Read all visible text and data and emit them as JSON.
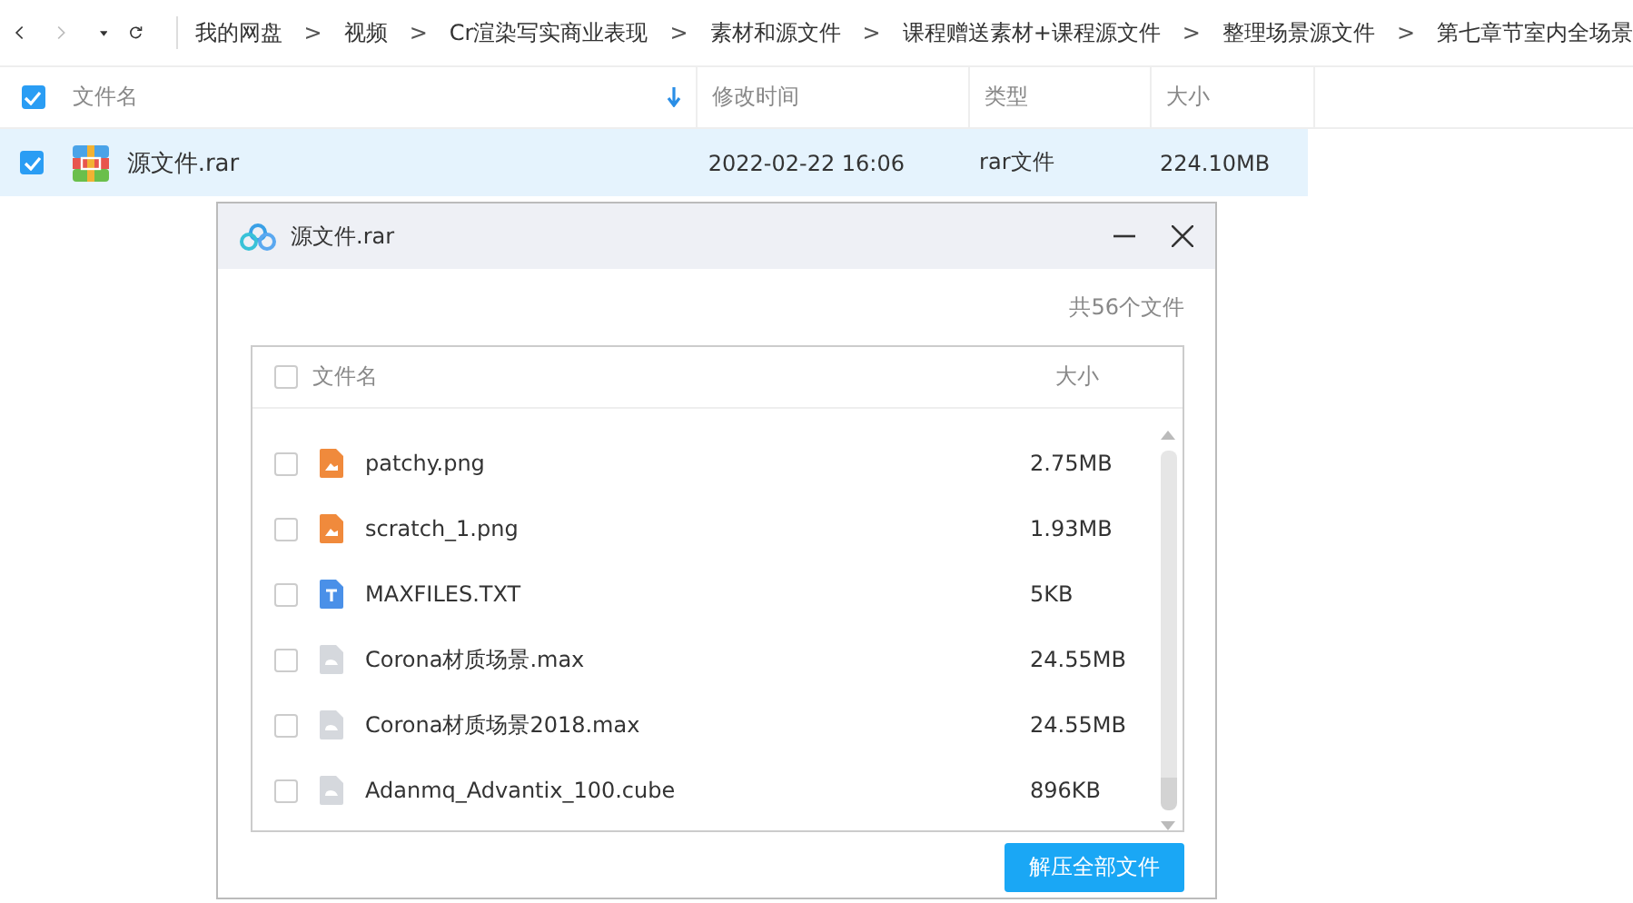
{
  "breadcrumb": {
    "separator": ">",
    "items": [
      "我的网盘",
      "视频",
      "Cr渲染写实商业表现",
      "素材和源文件",
      "课程赠送素材+课程源文件",
      "整理场景源文件",
      "第七章节室内全场景"
    ]
  },
  "table": {
    "select_all_checked": true,
    "columns": [
      {
        "label": "文件名",
        "sorted": true
      },
      {
        "label": "修改时间",
        "sorted": false
      },
      {
        "label": "类型",
        "sorted": false
      },
      {
        "label": "大小",
        "sorted": false
      }
    ],
    "rows": [
      {
        "name": "源文件.rar",
        "modified": "2022-02-22 16:06",
        "type": "rar文件",
        "size": "224.10MB",
        "checked": true,
        "selected": true
      }
    ]
  },
  "dialog": {
    "title": "源文件.rar",
    "count": "共56个文件",
    "select_all_checked": false,
    "columns": [
      "文件名",
      "大小"
    ],
    "files": [
      {
        "name": "patchy.png",
        "size": "2.75MB",
        "kind": "image",
        "checked": false
      },
      {
        "name": "scratch_1.png",
        "size": "1.93MB",
        "kind": "image",
        "checked": false
      },
      {
        "name": "MAXFILES.TXT",
        "size": "5KB",
        "kind": "text",
        "checked": false
      },
      {
        "name": "Corona材质场景.max",
        "size": "24.55MB",
        "kind": "generic",
        "checked": false
      },
      {
        "name": "Corona材质场景2018.max",
        "size": "24.55MB",
        "kind": "generic",
        "checked": false
      },
      {
        "name": "Adanmq_Advantix_100.cube",
        "size": "896KB",
        "kind": "generic",
        "checked": false
      }
    ],
    "button": "解压全部文件"
  }
}
